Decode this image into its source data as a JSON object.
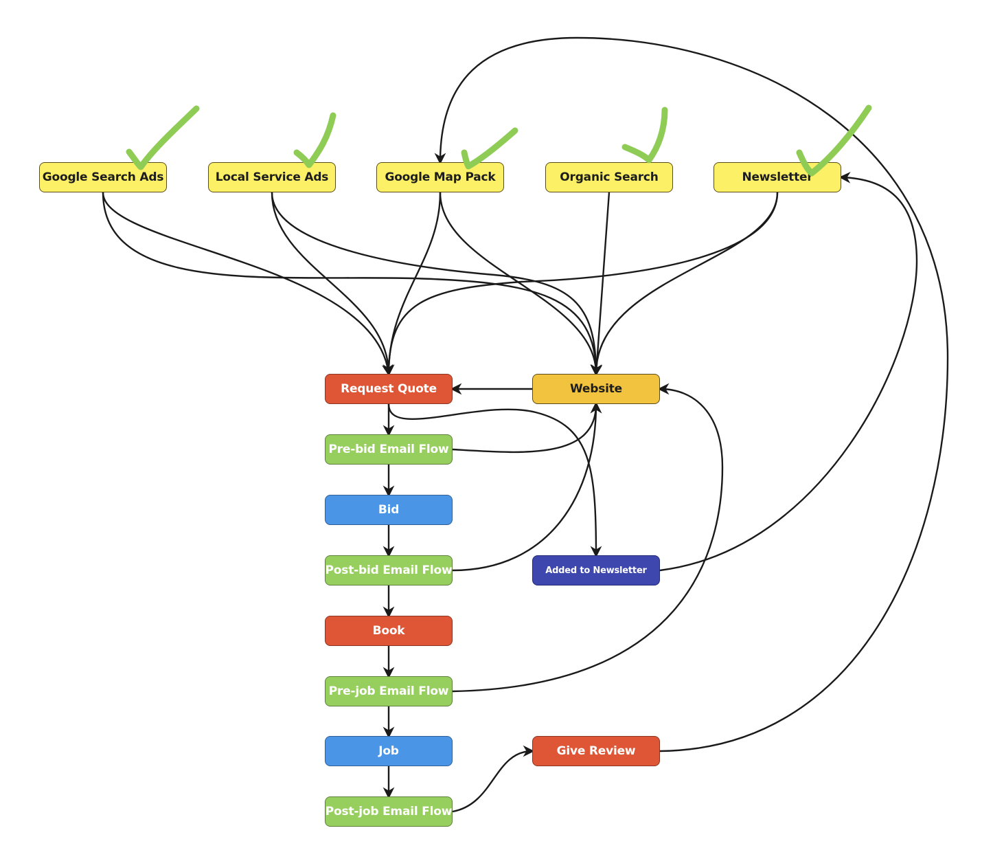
{
  "diagram": {
    "type": "flowchart",
    "colors": {
      "source": "#fbf066",
      "website": "#f1c33f",
      "action": "#df5636",
      "email_flow": "#97cf5e",
      "stage": "#4b95e6",
      "newsletter_list": "#3d47ad",
      "edge": "#1a1a1a",
      "checkmark": "#8fcc56"
    },
    "nodes": [
      {
        "id": "gsa",
        "label": "Google Search Ads",
        "style": "yellow",
        "checked": true
      },
      {
        "id": "lsa",
        "label": "Local Service Ads",
        "style": "yellow",
        "checked": true
      },
      {
        "id": "gmp",
        "label": "Google Map Pack",
        "style": "yellow",
        "checked": true
      },
      {
        "id": "org",
        "label": "Organic Search",
        "style": "yellow",
        "checked": true
      },
      {
        "id": "news",
        "label": "Newsletter",
        "style": "yellow",
        "checked": true
      },
      {
        "id": "rq",
        "label": "Request Quote",
        "style": "red",
        "checked": false
      },
      {
        "id": "web",
        "label": "Website",
        "style": "gold",
        "checked": false
      },
      {
        "id": "prebid",
        "label": "Pre-bid Email Flow",
        "style": "green",
        "checked": false
      },
      {
        "id": "bid",
        "label": "Bid",
        "style": "blue",
        "checked": false
      },
      {
        "id": "postbid",
        "label": "Post-bid Email Flow",
        "style": "green",
        "checked": false
      },
      {
        "id": "added",
        "label": "Added to Newsletter",
        "style": "indigo",
        "checked": false
      },
      {
        "id": "book",
        "label": "Book",
        "style": "red",
        "checked": false
      },
      {
        "id": "prejob",
        "label": "Pre-job Email Flow",
        "style": "green",
        "checked": false
      },
      {
        "id": "job",
        "label": "Job",
        "style": "blue",
        "checked": false
      },
      {
        "id": "review",
        "label": "Give Review",
        "style": "red",
        "checked": false
      },
      {
        "id": "postjob",
        "label": "Post-job Email Flow",
        "style": "green",
        "checked": false
      }
    ],
    "edges": [
      {
        "from": "gsa",
        "to": "rq"
      },
      {
        "from": "gsa",
        "to": "web"
      },
      {
        "from": "lsa",
        "to": "rq"
      },
      {
        "from": "lsa",
        "to": "web"
      },
      {
        "from": "gmp",
        "to": "rq"
      },
      {
        "from": "gmp",
        "to": "web"
      },
      {
        "from": "org",
        "to": "web"
      },
      {
        "from": "news",
        "to": "rq"
      },
      {
        "from": "news",
        "to": "web"
      },
      {
        "from": "web",
        "to": "rq"
      },
      {
        "from": "rq",
        "to": "prebid"
      },
      {
        "from": "rq",
        "to": "added"
      },
      {
        "from": "prebid",
        "to": "web"
      },
      {
        "from": "prebid",
        "to": "bid"
      },
      {
        "from": "bid",
        "to": "postbid"
      },
      {
        "from": "postbid",
        "to": "web"
      },
      {
        "from": "postbid",
        "to": "book"
      },
      {
        "from": "book",
        "to": "prejob"
      },
      {
        "from": "prejob",
        "to": "web"
      },
      {
        "from": "prejob",
        "to": "job"
      },
      {
        "from": "job",
        "to": "postjob"
      },
      {
        "from": "postjob",
        "to": "review"
      },
      {
        "from": "review",
        "to": "gmp"
      },
      {
        "from": "added",
        "to": "news"
      }
    ]
  }
}
